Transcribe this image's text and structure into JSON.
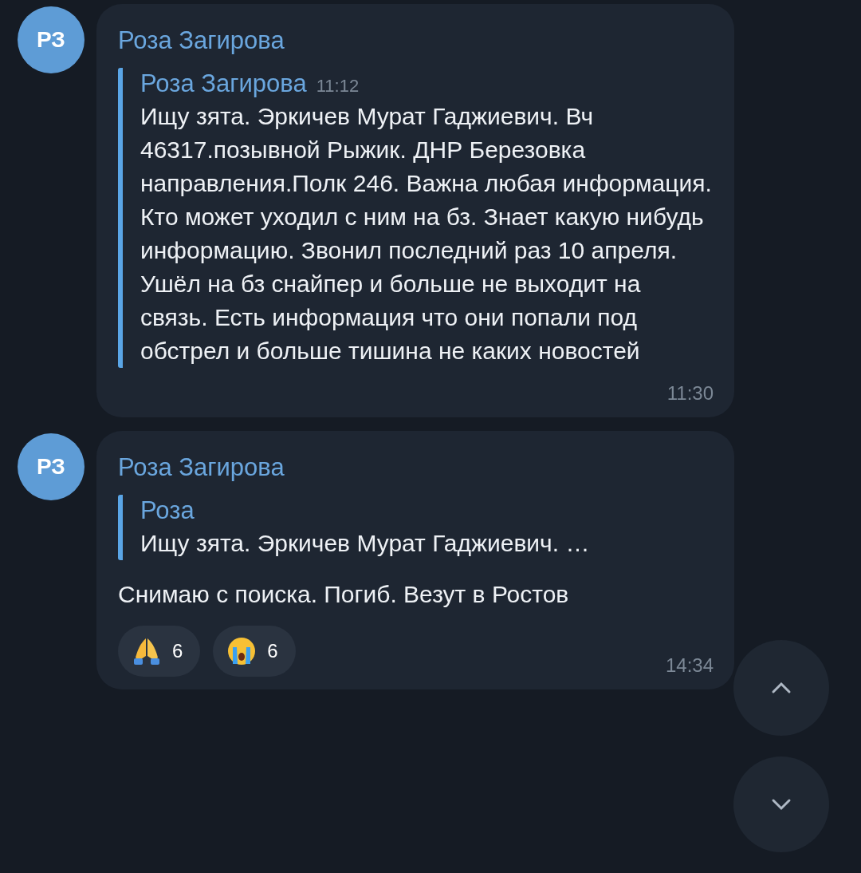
{
  "messages": [
    {
      "avatar": "РЗ",
      "sender": "Роза Загирова",
      "quote": {
        "sender": "Роза Загирова",
        "time": "11:12",
        "text": "Ищу зята. Эркичев Мурат Гаджиевич. Вч 46317.позывной Рыжик. ДНР Березовка направления.Полк 246. Важна любая информация. Кто может уходил с ним на бз. Знает какую нибудь информацию. Звонил последний раз 10 апреля. Ушёл на бз снайпер и больше не выходит на связь. Есть информация что они попали под обстрел и больше тишина не каких новостей"
      },
      "time": "11:30"
    },
    {
      "avatar": "РЗ",
      "sender": "Роза Загирова",
      "quote": {
        "sender": "Роза",
        "text": "Ищу зята. Эркичев Мурат Гаджиевич. …"
      },
      "text": "Снимаю с поиска. Погиб. Везут в Ростов",
      "reactions": [
        {
          "kind": "pray",
          "count": "6"
        },
        {
          "kind": "crying",
          "count": "6"
        }
      ],
      "time": "14:34"
    }
  ]
}
